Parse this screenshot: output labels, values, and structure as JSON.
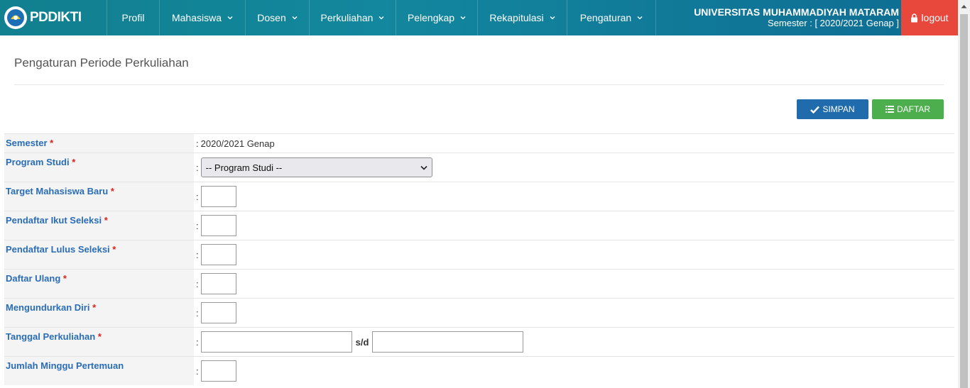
{
  "brand": {
    "name": "PDDIKTI"
  },
  "nav": {
    "items": [
      {
        "label": "Profil"
      },
      {
        "label": "Mahasiswa"
      },
      {
        "label": "Dosen"
      },
      {
        "label": "Perkuliahan"
      },
      {
        "label": "Pelengkap"
      },
      {
        "label": "Rekapitulasi"
      },
      {
        "label": "Pengaturan"
      }
    ],
    "university": "UNIVERSITAS MUHAMMADIYAH MATARAM",
    "semester": "Semester : [ 2020/2021 Genap ]",
    "logout": "logout"
  },
  "page": {
    "title": "Pengaturan Periode Perkuliahan"
  },
  "actions": {
    "save": "SIMPAN",
    "list": "DAFTAR"
  },
  "form": {
    "semester": {
      "label": "Semester",
      "value": "2020/2021 Genap"
    },
    "program_studi": {
      "label": "Program Studi",
      "selected": "-- Program Studi --"
    },
    "target": {
      "label": "Target Mahasiswa Baru"
    },
    "ikut_seleksi": {
      "label": "Pendaftar Ikut Seleksi"
    },
    "lulus_seleksi": {
      "label": "Pendaftar Lulus Seleksi"
    },
    "daftar_ulang": {
      "label": "Daftar Ulang"
    },
    "mengundurkan": {
      "label": "Mengundurkan Diri"
    },
    "tanggal": {
      "label": "Tanggal Perkuliahan",
      "sep": "s/d"
    },
    "minggu": {
      "label": "Jumlah Minggu Pertemuan"
    },
    "required_mark": "*",
    "colon": ":"
  },
  "colors": {
    "nav_bg": "#13879e",
    "logout_bg": "#e8473c",
    "save_bg": "#1f6bab",
    "list_bg": "#4cae4c",
    "label_color": "#2a6db5"
  }
}
